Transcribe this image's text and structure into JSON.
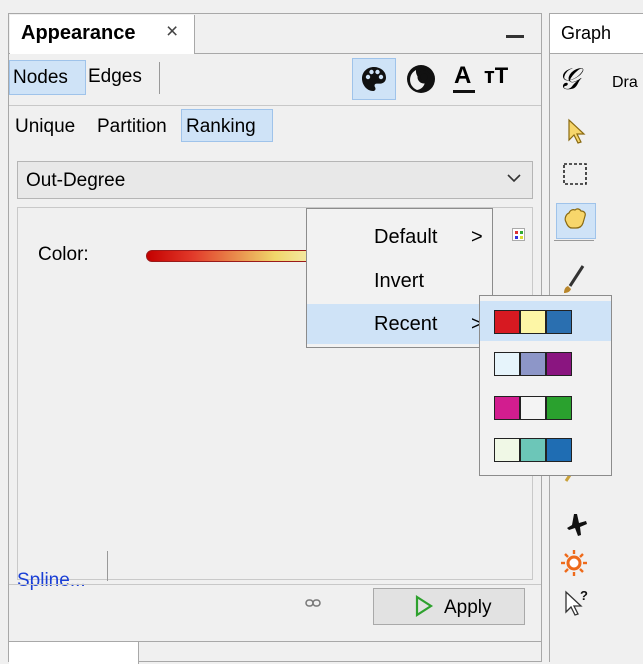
{
  "panel": {
    "title": "Appearance",
    "close_icon": "×",
    "element_tabs": [
      "Nodes",
      "Edges"
    ],
    "transform_icons": [
      "palette-icon",
      "size-icon",
      "label-color-icon",
      "label-size-icon"
    ],
    "label_color_glyph": "A",
    "label_size_glyph": "тT",
    "method_tabs": [
      "Unique",
      "Partition",
      "Ranking"
    ],
    "attribute_selected": "Out-Degree",
    "chevron": "⌵",
    "color_label": "Color:",
    "spline_link": "Spline...",
    "apply_label": "Apply",
    "bottom_tab_label": "",
    "colors": {
      "selected_tab_bg": "#cfe3f7",
      "link": "#1a3fd6",
      "apply_icon": "#2ea12e"
    }
  },
  "graph": {
    "tab_label": "Graph",
    "draw_label": "Dra",
    "tools": [
      "pointer-icon",
      "rect-select-icon",
      "drag-hand-icon",
      "brush-icon",
      "airplane-icon",
      "sun-icon",
      "help-cursor-icon"
    ]
  },
  "context_menu": {
    "items": [
      {
        "label": "Default",
        "arrow": ">"
      },
      {
        "label": "Invert",
        "arrow": ""
      },
      {
        "label": "Recent",
        "arrow": ">"
      }
    ]
  },
  "recent_palettes": [
    [
      "#d71921",
      "#fdf6a6",
      "#2a6fb0"
    ],
    [
      "#e6f4fb",
      "#8d96c8",
      "#8a1580"
    ],
    [
      "#d21d8f",
      "#f4f4f4",
      "#2aa12e"
    ],
    [
      "#f0f8e6",
      "#6cc6b8",
      "#1f6db3"
    ]
  ]
}
